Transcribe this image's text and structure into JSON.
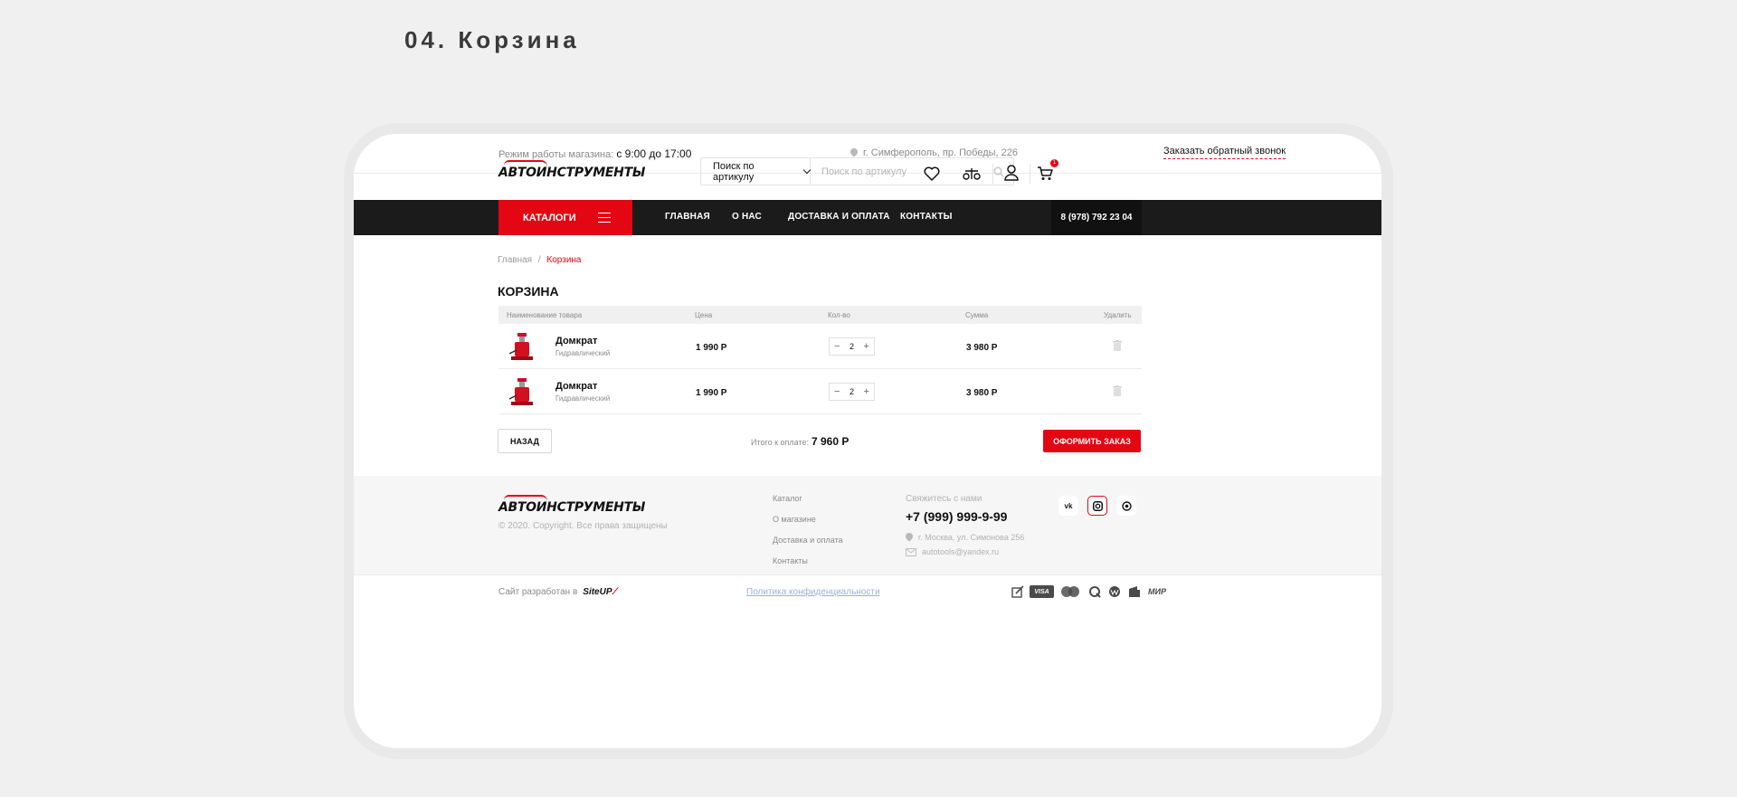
{
  "section_title": "04. Корзина",
  "topbar": {
    "hours_label": "Режим работы магазина:",
    "hours_value": "с 9:00 до 17:00",
    "address": "г. Симферополь, пр. Победы, 226",
    "callback": "Заказать обратный звонок"
  },
  "logo": {
    "text": "АВТОИНСТРУМЕНТЫ"
  },
  "search": {
    "select_value": "Поиск по артикулу",
    "placeholder": "Поиск по артикулу"
  },
  "header": {
    "cart_count": "1"
  },
  "nav": {
    "catalog_label": "КАТАЛОГИ",
    "items": [
      "ГЛАВНАЯ",
      "О НАС",
      "ДОСТАВКА И ОПЛАТА",
      "КОНТАКТЫ"
    ],
    "phone": "8 (978) 792 23 04"
  },
  "breadcrumbs": {
    "home": "Главная",
    "separator": "/",
    "current": "Корзина"
  },
  "page_title": "КОРЗИНА",
  "table": {
    "headers": {
      "name": "Наименование товара",
      "price": "Цена",
      "qty": "Кол-во",
      "sum": "Сумма",
      "delete": "Удалить"
    },
    "rows": [
      {
        "name": "Домкрат",
        "subtitle": "Гидравлический",
        "price": "1 990 Р",
        "qty": "2",
        "sum": "3 980 Р"
      },
      {
        "name": "Домкрат",
        "subtitle": "Гидравлический",
        "price": "1 990 Р",
        "qty": "2",
        "sum": "3 980 Р"
      }
    ]
  },
  "cart_footer": {
    "back_label": "НАЗАД",
    "total_label": "Итого к оплате:",
    "total_value": "7 960 Р",
    "order_label": "ОФОРМИТЬ ЗАКАЗ"
  },
  "footer": {
    "copyright": "© 2020. Copyright. Все права защищены",
    "links": [
      "Каталог",
      "О магазине",
      "Доставка и оплата",
      "Контакты"
    ],
    "contact_heading": "Свяжитесь с нами",
    "phone": "+7 (999) 999-9-99",
    "address": "г. Москва, ул. Симонова 256",
    "email": "autotools@yandex.ru",
    "social": {
      "vk": "vk"
    }
  },
  "bottom": {
    "developed_by": "Сайт разработан в",
    "developer": "SiteUP",
    "policy": "Политика конфиденциальности",
    "payments": {
      "visa": "VISA",
      "mir": "МИР"
    }
  },
  "colors": {
    "accent": "#e30613",
    "nav_bg": "#1b1b1b",
    "page_bg": "#f0f0f0"
  }
}
